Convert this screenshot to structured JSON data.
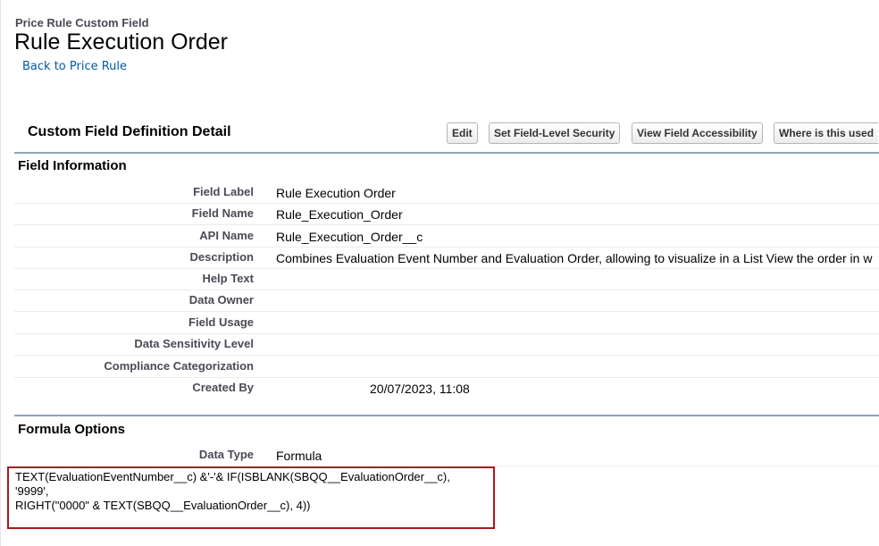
{
  "header": {
    "object_type": "Price Rule Custom Field",
    "title": "Rule Execution Order",
    "back_link": "Back to Price Rule"
  },
  "detail": {
    "title": "Custom Field Definition Detail",
    "buttons": {
      "edit": "Edit",
      "field_level_security": "Set Field-Level Security",
      "view_accessibility": "View Field Accessibility",
      "where_used": "Where is this used"
    }
  },
  "field_information": {
    "heading": "Field Information",
    "rows": [
      {
        "label": "Field Label",
        "value": "Rule Execution Order"
      },
      {
        "label": "Field Name",
        "value": "Rule_Execution_Order"
      },
      {
        "label": "API Name",
        "value": "Rule_Execution_Order__c"
      },
      {
        "label": "Description",
        "value": "Combines Evaluation Event Number and Evaluation Order, allowing to visualize in a List View the order in w"
      },
      {
        "label": "Help Text",
        "value": ""
      },
      {
        "label": "Data Owner",
        "value": ""
      },
      {
        "label": "Field Usage",
        "value": ""
      },
      {
        "label": "Data Sensitivity Level",
        "value": ""
      },
      {
        "label": "Compliance Categorization",
        "value": ""
      },
      {
        "label": "Created By",
        "value": "20/07/2023, 11:08"
      }
    ]
  },
  "formula_options": {
    "heading": "Formula Options",
    "data_type_label": "Data Type",
    "data_type_value": "Formula",
    "formula": "TEXT(EvaluationEventNumber__c) &'-'& IF(ISBLANK(SBQQ__EvaluationOrder__c),\n'9999',\nRIGHT(\"0000\" & TEXT(SBQQ__EvaluationOrder__c), 4))"
  },
  "colors": {
    "link": "#015ba7",
    "section_rule": "#8da5b9",
    "highlight_border": "#a8191d",
    "label_text": "#4a4a56"
  }
}
